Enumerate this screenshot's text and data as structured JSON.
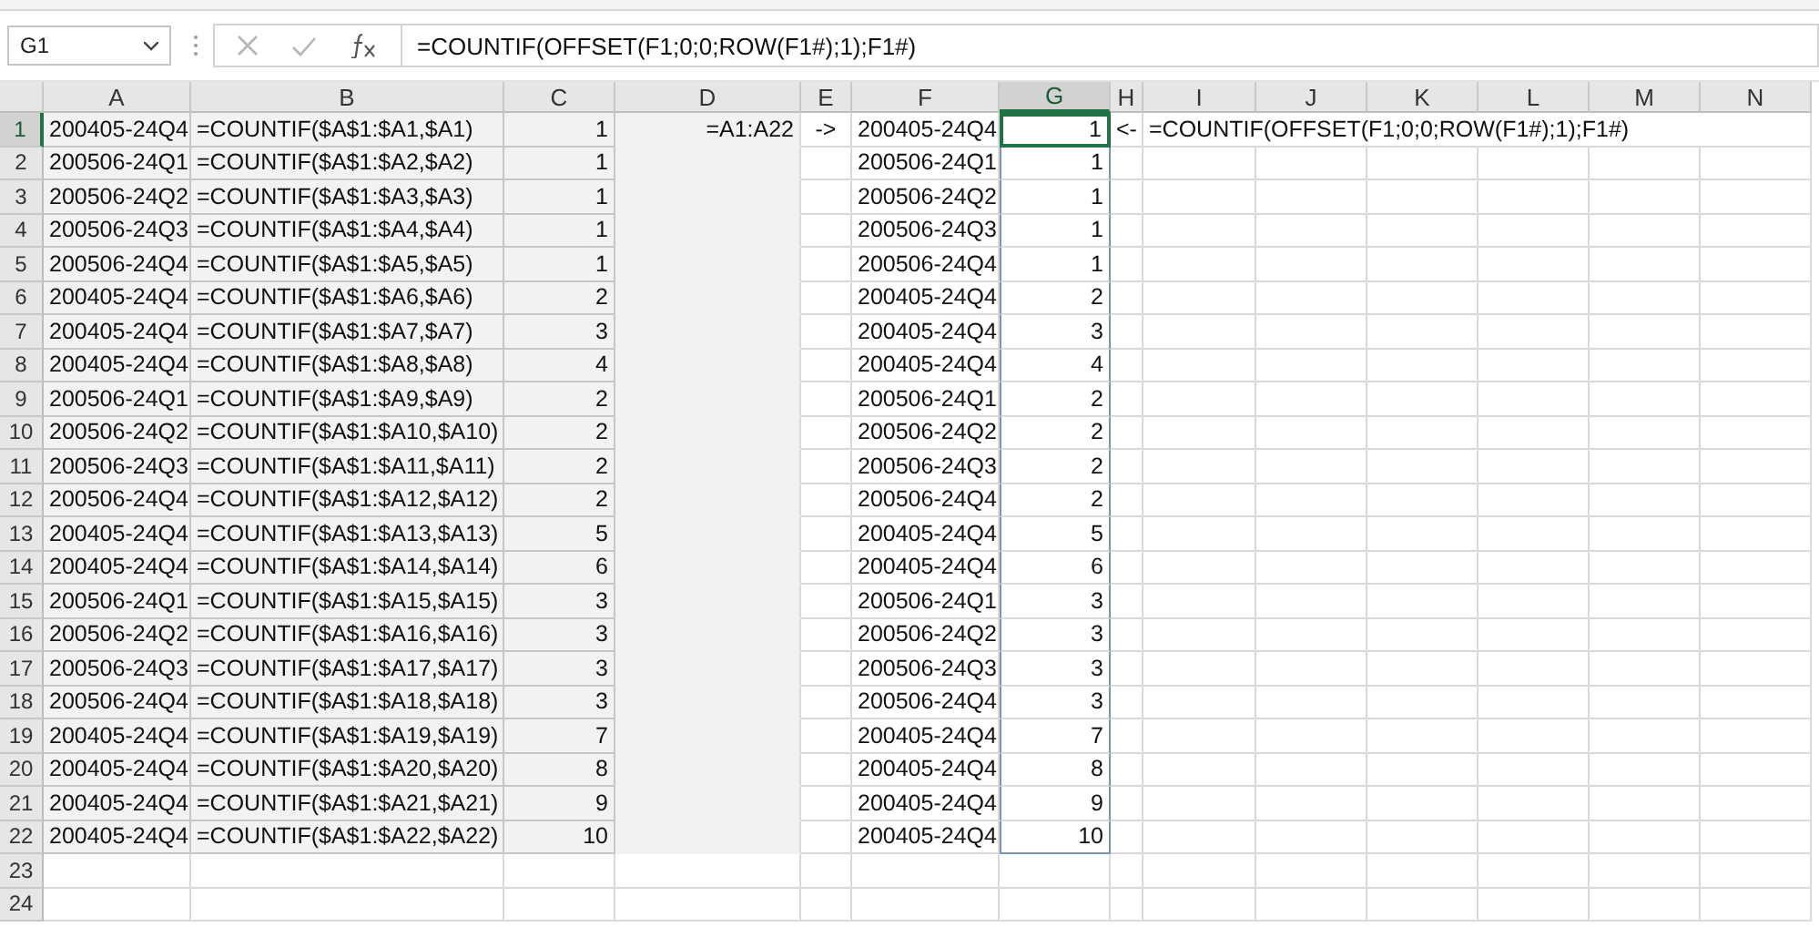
{
  "formula_bar": {
    "name_box": "G1",
    "formula": "=COUNTIF(OFFSET(F1;0;0;ROW(F1#);1);F1#)"
  },
  "columns": [
    {
      "label": "A",
      "selected": false
    },
    {
      "label": "B",
      "selected": false
    },
    {
      "label": "C",
      "selected": false
    },
    {
      "label": "D",
      "selected": false
    },
    {
      "label": "E",
      "selected": false
    },
    {
      "label": "F",
      "selected": false
    },
    {
      "label": "G",
      "selected": true
    },
    {
      "label": "H",
      "selected": false
    },
    {
      "label": "I",
      "selected": false
    },
    {
      "label": "J",
      "selected": false
    },
    {
      "label": "K",
      "selected": false
    },
    {
      "label": "L",
      "selected": false
    },
    {
      "label": "M",
      "selected": false
    },
    {
      "label": "N",
      "selected": false
    }
  ],
  "rows": [
    {
      "number": "1",
      "selected": true,
      "a": "200405-24Q4",
      "b": "=COUNTIF($A$1:$A1,$A1)",
      "c": "1",
      "d": "=A1:A22",
      "e": "->",
      "f": "200405-24Q4",
      "g": "1",
      "h": "<-",
      "i": "=COUNTIF(OFFSET(F1;0;0;ROW(F1#);1);F1#)"
    },
    {
      "number": "2",
      "selected": false,
      "a": "200506-24Q1",
      "b": "=COUNTIF($A$1:$A2,$A2)",
      "c": "1",
      "f": "200506-24Q1",
      "g": "1"
    },
    {
      "number": "3",
      "selected": false,
      "a": "200506-24Q2",
      "b": "=COUNTIF($A$1:$A3,$A3)",
      "c": "1",
      "f": "200506-24Q2",
      "g": "1"
    },
    {
      "number": "4",
      "selected": false,
      "a": "200506-24Q3",
      "b": "=COUNTIF($A$1:$A4,$A4)",
      "c": "1",
      "f": "200506-24Q3",
      "g": "1"
    },
    {
      "number": "5",
      "selected": false,
      "a": "200506-24Q4",
      "b": "=COUNTIF($A$1:$A5,$A5)",
      "c": "1",
      "f": "200506-24Q4",
      "g": "1"
    },
    {
      "number": "6",
      "selected": false,
      "a": "200405-24Q4",
      "b": "=COUNTIF($A$1:$A6,$A6)",
      "c": "2",
      "f": "200405-24Q4",
      "g": "2"
    },
    {
      "number": "7",
      "selected": false,
      "a": "200405-24Q4",
      "b": "=COUNTIF($A$1:$A7,$A7)",
      "c": "3",
      "f": "200405-24Q4",
      "g": "3"
    },
    {
      "number": "8",
      "selected": false,
      "a": "200405-24Q4",
      "b": "=COUNTIF($A$1:$A8,$A8)",
      "c": "4",
      "f": "200405-24Q4",
      "g": "4"
    },
    {
      "number": "9",
      "selected": false,
      "a": "200506-24Q1",
      "b": "=COUNTIF($A$1:$A9,$A9)",
      "c": "2",
      "f": "200506-24Q1",
      "g": "2"
    },
    {
      "number": "10",
      "selected": false,
      "a": "200506-24Q2",
      "b": "=COUNTIF($A$1:$A10,$A10)",
      "c": "2",
      "f": "200506-24Q2",
      "g": "2"
    },
    {
      "number": "11",
      "selected": false,
      "a": "200506-24Q3",
      "b": "=COUNTIF($A$1:$A11,$A11)",
      "c": "2",
      "f": "200506-24Q3",
      "g": "2"
    },
    {
      "number": "12",
      "selected": false,
      "a": "200506-24Q4",
      "b": "=COUNTIF($A$1:$A12,$A12)",
      "c": "2",
      "f": "200506-24Q4",
      "g": "2"
    },
    {
      "number": "13",
      "selected": false,
      "a": "200405-24Q4",
      "b": "=COUNTIF($A$1:$A13,$A13)",
      "c": "5",
      "f": "200405-24Q4",
      "g": "5"
    },
    {
      "number": "14",
      "selected": false,
      "a": "200405-24Q4",
      "b": "=COUNTIF($A$1:$A14,$A14)",
      "c": "6",
      "f": "200405-24Q4",
      "g": "6"
    },
    {
      "number": "15",
      "selected": false,
      "a": "200506-24Q1",
      "b": "=COUNTIF($A$1:$A15,$A15)",
      "c": "3",
      "f": "200506-24Q1",
      "g": "3"
    },
    {
      "number": "16",
      "selected": false,
      "a": "200506-24Q2",
      "b": "=COUNTIF($A$1:$A16,$A16)",
      "c": "3",
      "f": "200506-24Q2",
      "g": "3"
    },
    {
      "number": "17",
      "selected": false,
      "a": "200506-24Q3",
      "b": "=COUNTIF($A$1:$A17,$A17)",
      "c": "3",
      "f": "200506-24Q3",
      "g": "3"
    },
    {
      "number": "18",
      "selected": false,
      "a": "200506-24Q4",
      "b": "=COUNTIF($A$1:$A18,$A18)",
      "c": "3",
      "f": "200506-24Q4",
      "g": "3"
    },
    {
      "number": "19",
      "selected": false,
      "a": "200405-24Q4",
      "b": "=COUNTIF($A$1:$A19,$A19)",
      "c": "7",
      "f": "200405-24Q4",
      "g": "7"
    },
    {
      "number": "20",
      "selected": false,
      "a": "200405-24Q4",
      "b": "=COUNTIF($A$1:$A20,$A20)",
      "c": "8",
      "f": "200405-24Q4",
      "g": "8"
    },
    {
      "number": "21",
      "selected": false,
      "a": "200405-24Q4",
      "b": "=COUNTIF($A$1:$A21,$A21)",
      "c": "9",
      "f": "200405-24Q4",
      "g": "9"
    },
    {
      "number": "22",
      "selected": false,
      "a": "200405-24Q4",
      "b": "=COUNTIF($A$1:$A22,$A22)",
      "c": "10",
      "f": "200405-24Q4",
      "g": "10"
    },
    {
      "number": "23",
      "selected": false
    },
    {
      "number": "24",
      "selected": false
    }
  ]
}
